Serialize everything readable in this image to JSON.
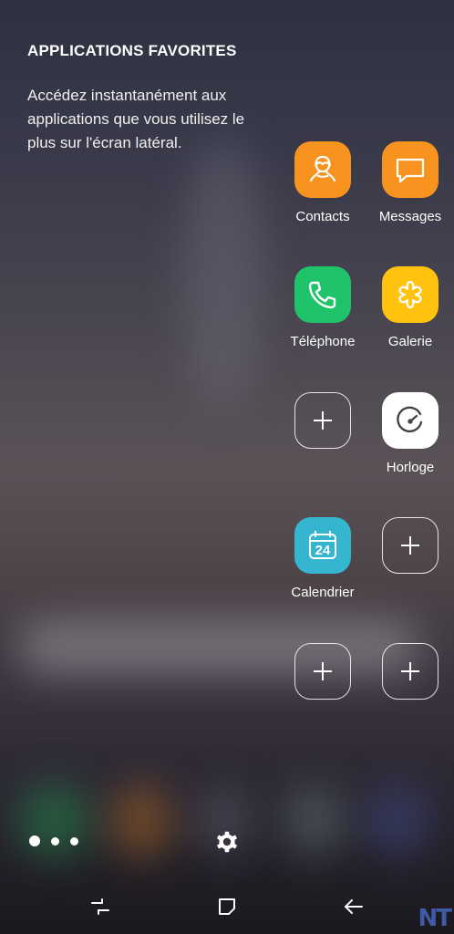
{
  "header": {
    "title": "APPLICATIONS FAVORITES",
    "description": "Accédez instantanément aux applications que vous utilisez le plus sur l'écran latéral."
  },
  "apps": {
    "contacts": {
      "label": "Contacts",
      "color": "#F7931E",
      "icon": "contacts-icon"
    },
    "messages": {
      "label": "Messages",
      "color": "#F7931E",
      "icon": "messages-icon"
    },
    "telephone": {
      "label": "Téléphone",
      "color": "#1FC46A",
      "icon": "phone-icon"
    },
    "galerie": {
      "label": "Galerie",
      "color": "#FFC20E",
      "icon": "gallery-icon"
    },
    "horloge": {
      "label": "Horloge",
      "color": "#FFFFFF",
      "icon": "clock-icon"
    },
    "calendrier": {
      "label": "Calendrier",
      "color": "#35B5D0",
      "icon": "calendar-icon",
      "day": "24"
    }
  },
  "empty_slots": 4,
  "footer": {
    "more_icon": "more-dots-icon",
    "settings_icon": "gear-icon"
  },
  "navbar": {
    "recents_icon": "recents-icon",
    "home_icon": "home-icon",
    "back_icon": "back-arrow-icon"
  },
  "watermark": "NT"
}
